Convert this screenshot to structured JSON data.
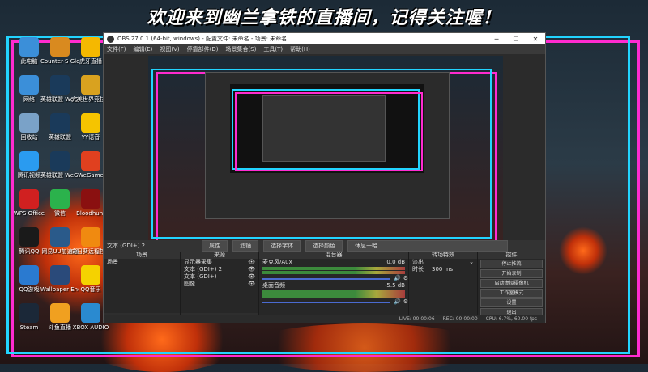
{
  "banner": "欢迎来到幽兰拿铁的直播间，记得关注喔！",
  "desktop_icons": [
    {
      "label": "此电脑",
      "icon": "computer-icon",
      "color": "#3b8fd9"
    },
    {
      "label": "Counter-S Global Of...",
      "icon": "csgo-icon",
      "color": "#d98a1f"
    },
    {
      "label": "虎牙直播",
      "icon": "huya-icon",
      "color": "#f5b800"
    },
    {
      "label": "网络",
      "icon": "network-icon",
      "color": "#3b8fd9"
    },
    {
      "label": "英雄联盟 WeGame版",
      "icon": "lol-icon",
      "color": "#1a3a5a"
    },
    {
      "label": "完美世界竞技平台",
      "icon": "perfect-world-icon",
      "color": "#d9a21f"
    },
    {
      "label": "回收站",
      "icon": "recycle-bin-icon",
      "color": "#7aa2c8"
    },
    {
      "label": "英雄联盟",
      "icon": "lol-icon",
      "color": "#1a3a5a"
    },
    {
      "label": "YY语音",
      "icon": "yy-icon",
      "color": "#f5c400"
    },
    {
      "label": "腾讯视频",
      "icon": "tencent-video-icon",
      "color": "#2a9bf0"
    },
    {
      "label": "英雄联盟 WeGame版",
      "icon": "lol-icon",
      "color": "#1a3a5a"
    },
    {
      "label": "WeGame",
      "icon": "wegame-icon",
      "color": "#e0401f"
    },
    {
      "label": "WPS Office",
      "icon": "wps-icon",
      "color": "#d02020"
    },
    {
      "label": "微信",
      "icon": "wechat-icon",
      "color": "#2bb24c"
    },
    {
      "label": "Bloodhunt",
      "icon": "bloodhunt-icon",
      "color": "#8a1010"
    },
    {
      "label": "腾讯QQ",
      "icon": "qq-icon",
      "color": "#1a1a1a"
    },
    {
      "label": "网易UU加速器",
      "icon": "uu-icon",
      "color": "#2a5a8a"
    },
    {
      "label": "向日葵远程控制",
      "icon": "sunflower-icon",
      "color": "#f08a10"
    },
    {
      "label": "QQ游戏",
      "icon": "qq-game-icon",
      "color": "#2a7ad0"
    },
    {
      "label": "Wallpaper Engine:...",
      "icon": "wallpaper-engine-icon",
      "color": "#2a4a7a"
    },
    {
      "label": "QQ音乐",
      "icon": "qq-music-icon",
      "color": "#f5d200"
    },
    {
      "label": "Steam",
      "icon": "steam-icon",
      "color": "#1b2838"
    },
    {
      "label": "斗鱼直播",
      "icon": "douyu-icon",
      "color": "#f0a020"
    },
    {
      "label": "XBOX AUDIO",
      "icon": "xbox-audio-icon",
      "color": "#2a8ad0"
    }
  ],
  "obs": {
    "title": "OBS 27.0.1 (64-bit, windows) - 配置文件: 未命名 - 场景: 未命名",
    "menu": [
      "文件(F)",
      "编辑(E)",
      "视图(V)",
      "停靠部件(D)",
      "场景集合(S)",
      "工具(T)",
      "帮助(H)"
    ],
    "source_bar": {
      "source_name": "文本 (GDI+) 2",
      "buttons": [
        "属性",
        "滤镜",
        "选择字体",
        "选择颜色"
      ],
      "text_value": "休息一哈"
    },
    "docks": {
      "scenes": {
        "title": "场景",
        "items": [
          "场景"
        ]
      },
      "sources": {
        "title": "来源",
        "items": [
          "显示器采集",
          "文本 (GDI+) 2",
          "文本 (GDI+)",
          "图像"
        ]
      },
      "mixer": {
        "title": "混音器",
        "channels": [
          {
            "name": "麦克风/Aux",
            "db": "0.0 dB"
          },
          {
            "name": "桌面音频",
            "db": "-5.5 dB"
          }
        ]
      },
      "transitions": {
        "title": "转场特效",
        "type": "淡出",
        "duration_label": "时长",
        "duration": "300 ms"
      },
      "controls": {
        "title": "控件",
        "buttons": [
          "停止推流",
          "开始录制",
          "启动虚拟摄像机",
          "工作室模式",
          "设置",
          "退出"
        ]
      }
    },
    "status": {
      "live": "LIVE: 00:00:06",
      "rec": "REC: 00:00:00",
      "cpu": "CPU: 6.7%, 60.00 fps"
    }
  }
}
